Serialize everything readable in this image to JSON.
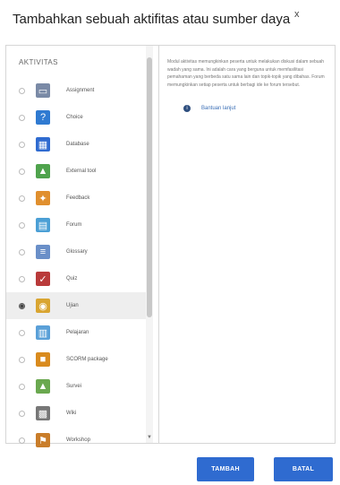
{
  "dialog": {
    "title": "Tambahkan sebuah aktifitas atau sumber daya",
    "close": "x"
  },
  "activities": {
    "header": "AKTIVITAS",
    "items": [
      {
        "label": "Assignment",
        "icon": "assignment-icon",
        "color": "#7a8aa6",
        "glyph": "▭"
      },
      {
        "label": "Choice",
        "icon": "choice-icon",
        "color": "#2f7ad1",
        "glyph": "?"
      },
      {
        "label": "Database",
        "icon": "database-icon",
        "color": "#2f6bd0",
        "glyph": "▦"
      },
      {
        "label": "External tool",
        "icon": "external-tool-icon",
        "color": "#4fa34d",
        "glyph": "▲"
      },
      {
        "label": "Feedback",
        "icon": "feedback-icon",
        "color": "#e08f2e",
        "glyph": "✦"
      },
      {
        "label": "Forum",
        "icon": "forum-icon",
        "color": "#4b9fd5",
        "glyph": "▤"
      },
      {
        "label": "Glossary",
        "icon": "glossary-icon",
        "color": "#6a8fc8",
        "glyph": "≡"
      },
      {
        "label": "Quiz",
        "icon": "quiz-icon",
        "color": "#b93a3a",
        "glyph": "✓"
      },
      {
        "label": "Ujian",
        "icon": "exam-icon",
        "color": "#d9a531",
        "glyph": "◉",
        "selected": true
      },
      {
        "label": "Pelajaran",
        "icon": "lesson-icon",
        "color": "#5aa0d8",
        "glyph": "▥"
      },
      {
        "label": "SCORM package",
        "icon": "scorm-package-icon",
        "color": "#d98b1e",
        "glyph": "■"
      },
      {
        "label": "Survei",
        "icon": "survey-icon",
        "color": "#6aa84f",
        "glyph": "▲"
      },
      {
        "label": "Wiki",
        "icon": "wiki-icon",
        "color": "#777777",
        "glyph": "▩"
      },
      {
        "label": "Workshop",
        "icon": "workshop-icon",
        "color": "#c97d2a",
        "glyph": "⚑"
      }
    ]
  },
  "description": {
    "text": "Modul aktivitas memungkinkan peserta untuk melakukan diskusi dalam sebuah wadah yang sama. Ini adalah cara yang berguna untuk memfasilitasi pemahaman yang berbeda satu sama lain dan topik-topik yang dibahas. Forum memungkinkan setiap peserta untuk berbagi ide ke forum tersebut.",
    "help_link": "Bantuan lanjut"
  },
  "buttons": {
    "add": "TAMBAH",
    "cancel": "BATAL"
  },
  "colors": {
    "primary": "#2f6bd0",
    "selected_row": "#eeeeee",
    "border": "#d6d6d6"
  }
}
